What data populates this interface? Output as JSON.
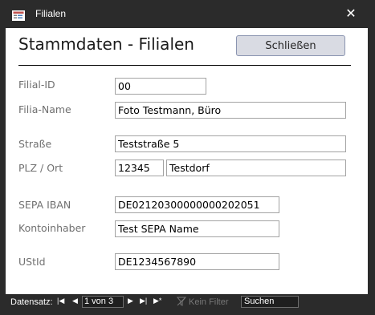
{
  "window": {
    "title": "Filialen",
    "close_glyph": "✕",
    "icon": "form-icon"
  },
  "form": {
    "title": "Stammdaten - Filialen",
    "close_button_label": "Schließen"
  },
  "fields": {
    "filial_id": {
      "label": "Filial-ID",
      "value": "00"
    },
    "filial_name": {
      "label": "Filia-Name",
      "value": "Foto Testmann, Büro"
    },
    "strasse": {
      "label": "Straße",
      "value": "Teststraße 5"
    },
    "plz_ort": {
      "label": "PLZ / Ort",
      "plz": "12345",
      "ort": "Testdorf"
    },
    "sepa_iban": {
      "label": "SEPA IBAN",
      "value": "DE02120300000000202051"
    },
    "kontoinhaber": {
      "label": "Kontoinhaber",
      "value": "Test SEPA Name"
    },
    "ustid": {
      "label": "UStId",
      "value": "DE1234567890"
    }
  },
  "navigation": {
    "label": "Datensatz:",
    "first_glyph": "|◀",
    "prev_glyph": "◀",
    "record": "1 von 3",
    "next_glyph": "▶",
    "last_glyph": "▶|",
    "new_glyph": "▶*",
    "filter_icon": "filter-off-icon",
    "filter_label": "Kein Filter",
    "search_label": "Suchen"
  },
  "colors": {
    "frame": "#2b2b2b",
    "client": "#ffffff",
    "button": "#d9dbe3",
    "label": "#707070"
  }
}
